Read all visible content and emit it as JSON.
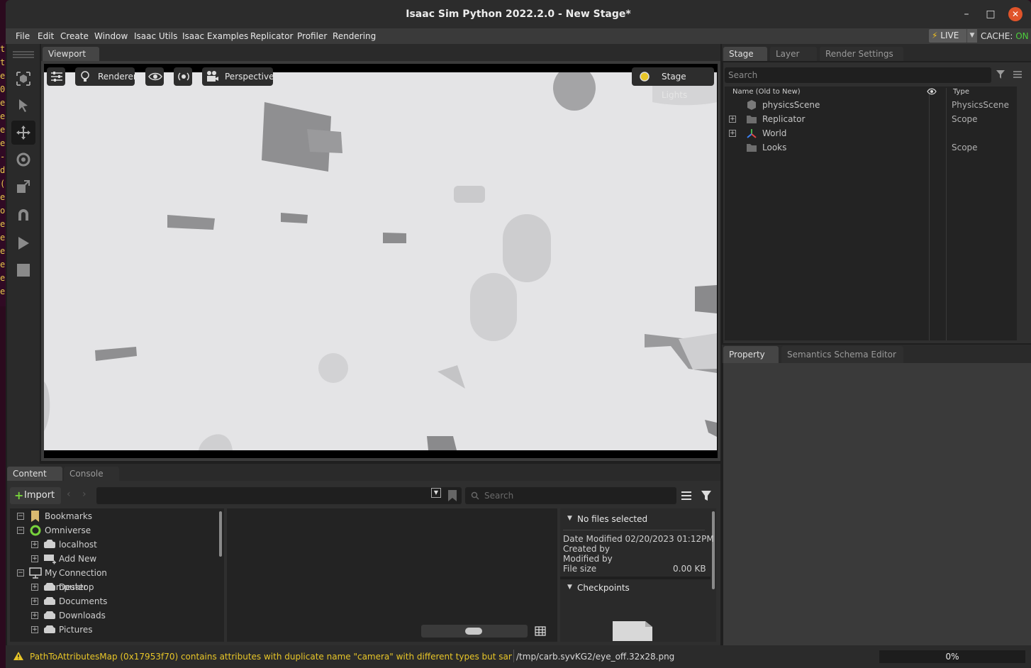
{
  "window": {
    "title": "Isaac Sim Python 2022.2.0 - New Stage*",
    "minimize_glyph": "–",
    "maximize_glyph": "□",
    "close_glyph": "✕"
  },
  "menubar": {
    "items": [
      "File",
      "Edit",
      "Create",
      "Window",
      "Isaac Utils",
      "Isaac Examples",
      "Replicator",
      "Profiler",
      "Rendering"
    ],
    "live_label": "LIVE",
    "cache_label": "CACHE:",
    "cache_state": "ON"
  },
  "viewport": {
    "tab": "Viewport",
    "renderer_label": "Renderer",
    "camera_label": "Perspective",
    "lights_label": "Stage Lights"
  },
  "stage": {
    "tabs": [
      "Stage",
      "Layer",
      "Render Settings"
    ],
    "search_placeholder": "Search",
    "col_name": "Name (Old to New)",
    "col_type": "Type",
    "rows": [
      {
        "name": "physicsScene",
        "type": "PhysicsScene",
        "icon": "physics-scene-icon",
        "expandable": false
      },
      {
        "name": "Replicator",
        "type": "Scope",
        "icon": "folder-icon",
        "expandable": true
      },
      {
        "name": "World",
        "type": "",
        "icon": "xform-axes-icon",
        "expandable": true
      },
      {
        "name": "Looks",
        "type": "Scope",
        "icon": "folder-icon",
        "expandable": false
      }
    ]
  },
  "property": {
    "tabs": [
      "Property",
      "Semantics Schema Editor"
    ]
  },
  "content": {
    "tabs": [
      "Content",
      "Console"
    ],
    "import_label": "Import",
    "search_placeholder": "Search",
    "tree": [
      {
        "label": "Bookmarks",
        "level": 0,
        "exp": "−",
        "icon": "bookmark-icon"
      },
      {
        "label": "Omniverse",
        "level": 0,
        "exp": "−",
        "icon": "omniverse-icon"
      },
      {
        "label": "localhost",
        "level": 1,
        "exp": "+",
        "icon": "server-icon"
      },
      {
        "label": "Add New Connection ...",
        "level": 1,
        "exp": "+",
        "icon": "add-connection-icon"
      },
      {
        "label": "My Computer",
        "level": 0,
        "exp": "−",
        "icon": "computer-icon"
      },
      {
        "label": "Desktop",
        "level": 1,
        "exp": "+",
        "icon": "drive-icon"
      },
      {
        "label": "Documents",
        "level": 1,
        "exp": "+",
        "icon": "drive-icon"
      },
      {
        "label": "Downloads",
        "level": 1,
        "exp": "+",
        "icon": "drive-icon"
      },
      {
        "label": "Pictures",
        "level": 1,
        "exp": "+",
        "icon": "drive-icon"
      }
    ],
    "info": {
      "header": "No files selected",
      "date_modified_label": "Date Modified",
      "date_modified": "02/20/2023 01:12PM",
      "created_by_label": "Created by",
      "modified_by_label": "Modified by",
      "file_size_label": "File size",
      "file_size": "0.00 KB",
      "checkpoints": "Checkpoints"
    }
  },
  "statusbar": {
    "warning": "PathToAttributesMap (0x17953f70) contains attributes with duplicate name \"camera\" with different types but same per-element",
    "file": "/tmp/carb.syvKG2/eye_off.32x28.png",
    "progress": "0%"
  },
  "terminal_glyphs": [
    "t",
    "t",
    "e",
    "0",
    "e",
    "e",
    "e",
    "e",
    "-",
    "d",
    "(",
    "e",
    "o",
    "e",
    "e",
    "e",
    "e",
    "e",
    "e"
  ],
  "colors": {
    "accent_green": "#4cce3c",
    "warning_yellow": "#e8c628",
    "close_orange": "#e0542a"
  }
}
